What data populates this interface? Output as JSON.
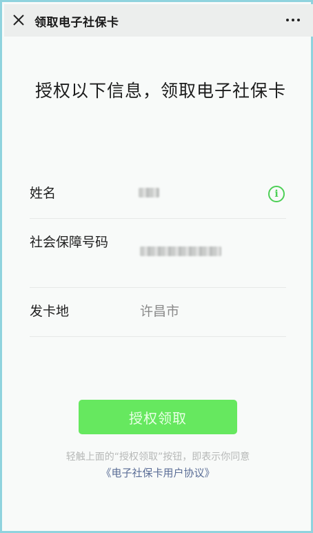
{
  "titlebar": {
    "title": "领取电子社保卡",
    "close_icon": "close-icon",
    "more_icon": "more-icon"
  },
  "heading": "授权以下信息，领取电子社保卡",
  "fields": [
    {
      "label": "姓名",
      "value": "",
      "redacted": true,
      "info_icon": "info-icon"
    },
    {
      "label": "社会保障号码",
      "value": "",
      "redacted": true
    },
    {
      "label": "发卡地",
      "value": "许昌市",
      "redacted": false
    }
  ],
  "submit_label": "授权领取",
  "note": "轻触上面的“授权领取”按钮，即表示你同意",
  "agreement_link": "《电子社保卡用户协议》",
  "colors": {
    "accent": "#66e85f",
    "info": "#4ccf55",
    "link": "#5a6d96"
  }
}
